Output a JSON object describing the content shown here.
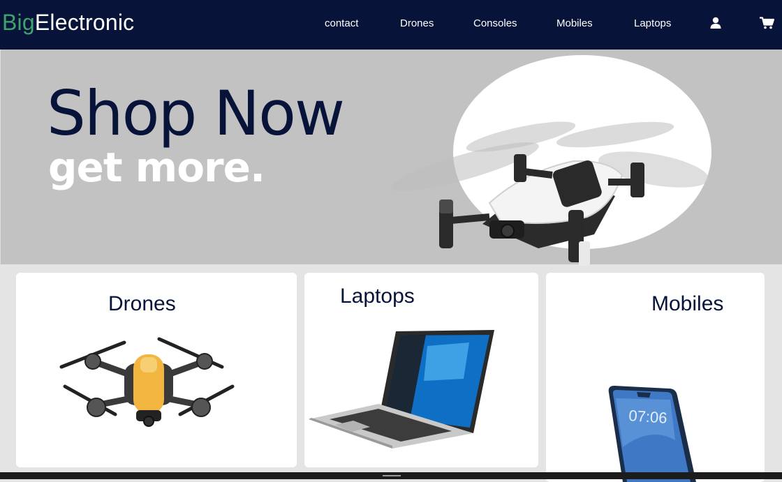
{
  "brand": {
    "part1": "Big",
    "part2": "Electronic"
  },
  "nav": {
    "contact": "contact",
    "drones": "Drones",
    "consoles": "Consoles",
    "mobiles": "Mobiles",
    "laptops": "Laptops",
    "icons": [
      "user-icon",
      "cart-icon"
    ]
  },
  "hero": {
    "title": "Shop Now",
    "subtitle": "get more."
  },
  "categories": [
    {
      "title": "Drones",
      "image": "drone"
    },
    {
      "title": "Laptops",
      "image": "laptop"
    },
    {
      "title": "Mobiles",
      "image": "phone"
    }
  ],
  "colors": {
    "navbar": "#08133a",
    "brand_accent": "#3fa36d",
    "hero_bg": "#c2c2c2",
    "page_bg": "#e4e4e4"
  }
}
